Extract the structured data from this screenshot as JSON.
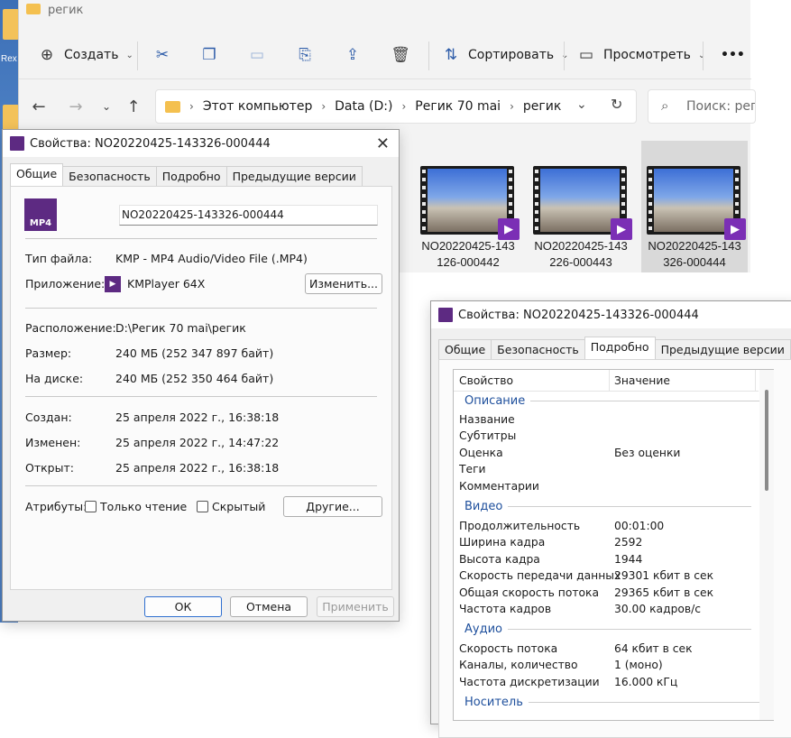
{
  "desktop": {
    "label": "Rex"
  },
  "explorer": {
    "title": "регик",
    "toolbar": {
      "create": "Создать",
      "sort": "Сортировать",
      "view": "Просмотреть",
      "more": "•••"
    },
    "breadcrumb": [
      "Этот компьютер",
      "Data (D:)",
      "Регик 70 mai",
      "регик"
    ],
    "search_placeholder": "Поиск: реги",
    "files": [
      {
        "line1": "NO20220425-143",
        "line2": "126-000442",
        "selected": false
      },
      {
        "line1": "NO20220425-143",
        "line2": "226-000443",
        "selected": false
      },
      {
        "line1": "NO20220425-143",
        "line2": "326-000444",
        "selected": true
      }
    ]
  },
  "dialog1": {
    "title": "Свойства: NO20220425-143326-000444",
    "tabs": [
      "Общие",
      "Безопасность",
      "Подробно",
      "Предыдущие версии"
    ],
    "active_tab": 0,
    "icon_text": "MP4",
    "filename": "NO20220425-143326-000444",
    "file_type_label": "Тип файла:",
    "file_type": "KMP - MP4 Audio/Video File (.MP4)",
    "app_label": "Приложение:",
    "app_name": "KMPlayer 64X",
    "change_button": "Изменить...",
    "location_label": "Расположение:",
    "location": "D:\\Регик 70 mai\\регик",
    "size_label": "Размер:",
    "size": "240 МБ (252 347 897 байт)",
    "disk_label": "На диске:",
    "disk": "240 МБ (252 350 464 байт)",
    "created_label": "Создан:",
    "created": "25 апреля 2022 г., 16:38:18",
    "modified_label": "Изменен:",
    "modified": "25 апреля 2022 г., 14:47:22",
    "opened_label": "Открыт:",
    "opened": "25 апреля 2022 г., 16:38:18",
    "attributes_label": "Атрибуты:",
    "readonly_label": "Только чтение",
    "hidden_label": "Скрытый",
    "other_button": "Другие...",
    "ok": "ОК",
    "cancel": "Отмена",
    "apply": "Применить"
  },
  "dialog2": {
    "title": "Свойства: NO20220425-143326-000444",
    "tabs": [
      "Общие",
      "Безопасность",
      "Подробно",
      "Предыдущие версии"
    ],
    "active_tab": 2,
    "col_property": "Свойство",
    "col_value": "Значение",
    "groups": {
      "description": "Описание",
      "video": "Видео",
      "audio": "Аудио",
      "media": "Носитель"
    },
    "description_rows": [
      {
        "k": "Название",
        "v": ""
      },
      {
        "k": "Субтитры",
        "v": ""
      },
      {
        "k": "Оценка",
        "v": "Без оценки"
      },
      {
        "k": "Теги",
        "v": ""
      },
      {
        "k": "Комментарии",
        "v": ""
      }
    ],
    "video_rows": [
      {
        "k": "Продолжительность",
        "v": "00:01:00"
      },
      {
        "k": "Ширина кадра",
        "v": "2592"
      },
      {
        "k": "Высота кадра",
        "v": "1944"
      },
      {
        "k": "Скорость передачи данных",
        "v": "29301 кбит в сек"
      },
      {
        "k": "Общая скорость потока",
        "v": "29365 кбит в сек"
      },
      {
        "k": "Частота кадров",
        "v": "30.00 кадров/с"
      }
    ],
    "audio_rows": [
      {
        "k": "Скорость потока",
        "v": "64 кбит в сек"
      },
      {
        "k": "Каналы, количество",
        "v": "1 (моно)"
      },
      {
        "k": "Частота дискретизации",
        "v": "16.000 кГц"
      }
    ]
  }
}
